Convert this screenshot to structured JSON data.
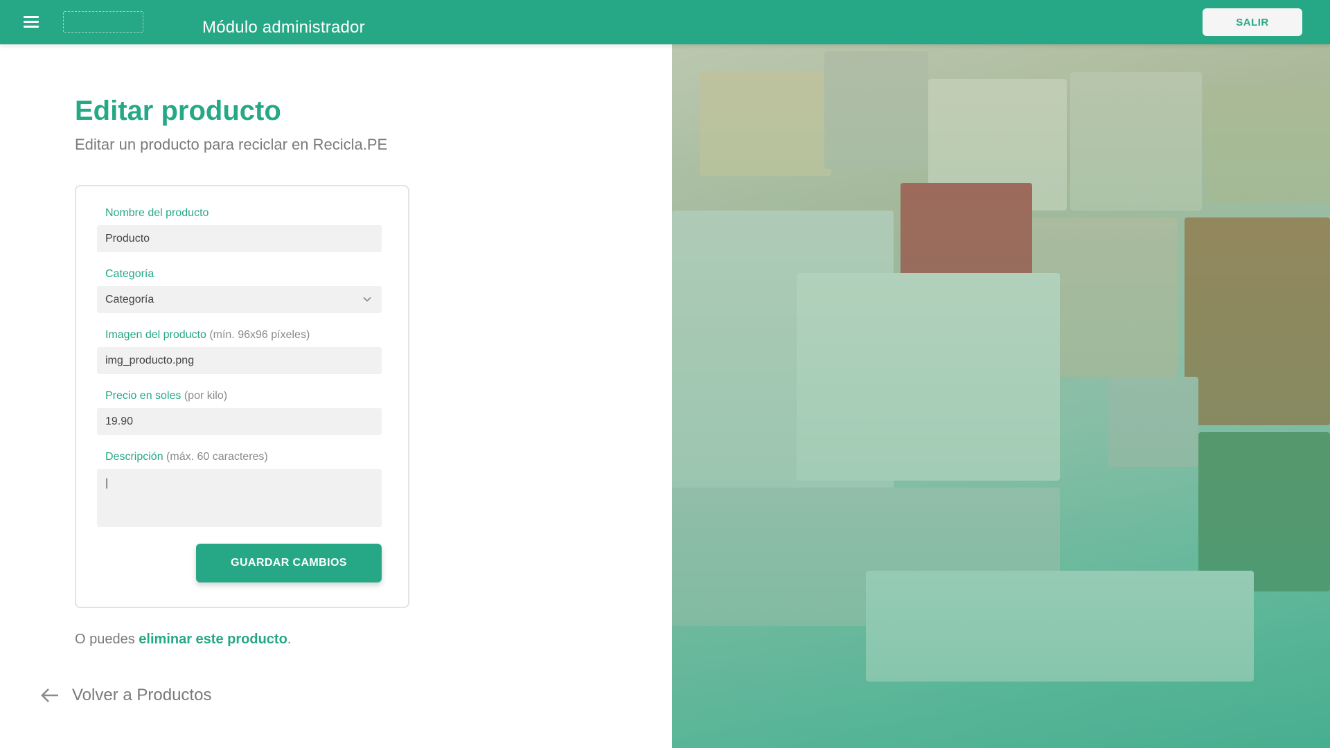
{
  "header": {
    "module_title": "Módulo administrador",
    "exit_label": "SALIR"
  },
  "page": {
    "title": "Editar producto",
    "subtitle": "Editar un producto para reciclar en Recicla.PE"
  },
  "form": {
    "name_label": "Nombre del producto",
    "name_value": "Producto",
    "category_label": "Categoría",
    "category_value": "Categoría",
    "image_label": "Imagen del producto",
    "image_hint": "(mín. 96x96 píxeles)",
    "image_value": "img_producto.png",
    "price_label": "Precio en soles",
    "price_hint": "(por kilo)",
    "price_value": "19.90",
    "description_label": "Descripción",
    "description_hint": "(máx. 60 caracteres)",
    "description_value": "|",
    "save_label": "GUARDAR CAMBIOS"
  },
  "delete_prompt": {
    "prefix": "O puedes",
    "link": "eliminar este producto",
    "suffix": "."
  },
  "back": {
    "label": "Volver a Productos"
  },
  "colors": {
    "accent": "#26a886",
    "text_muted": "#7a7a7a",
    "field_bg": "#f1f1f1"
  },
  "icons": [
    "menu-icon",
    "chevron-down-icon",
    "arrow-left-icon"
  ]
}
